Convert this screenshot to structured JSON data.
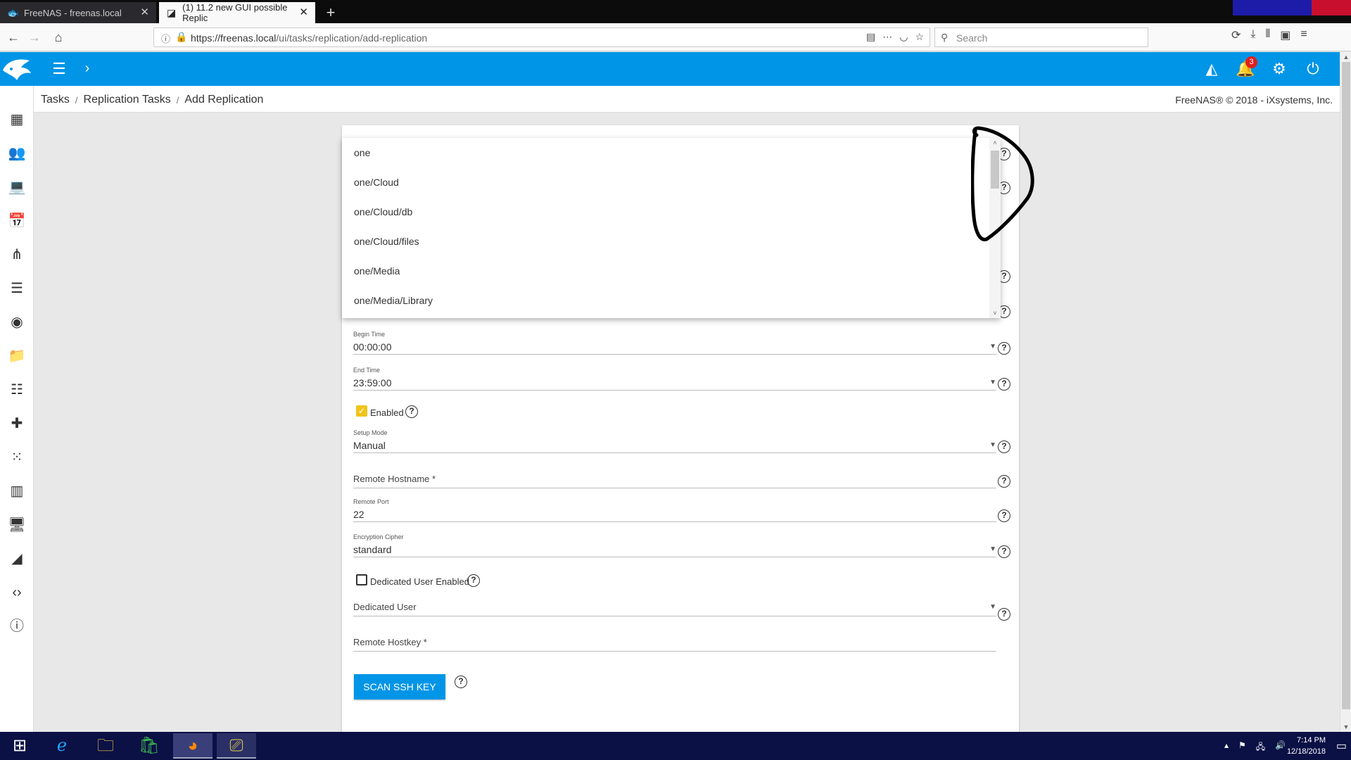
{
  "browser": {
    "tabs": [
      {
        "title": "FreeNAS - freenas.local",
        "active": false
      },
      {
        "title": "(1) 11.2 new GUI possible Replic",
        "active": true
      }
    ],
    "url_prefix": "https://freenas.local",
    "url_path": "/ui/tasks/replication/add-replication",
    "search_placeholder": "Search",
    "tab_close_glyph": "✕",
    "new_tab_glyph": "+"
  },
  "header": {
    "notification_count": "3"
  },
  "breadcrumb": {
    "items": [
      "Tasks",
      "Replication Tasks",
      "Add Replication"
    ],
    "separator": "/"
  },
  "copyright": "FreeNAS® © 2018 - iXsystems, Inc.",
  "dropdown": {
    "options": [
      "one",
      "one/Cloud",
      "one/Cloud/db",
      "one/Cloud/files",
      "one/Media",
      "one/Media/Library"
    ]
  },
  "form": {
    "begin_time": {
      "label": "Begin Time",
      "value": "00:00:00"
    },
    "end_time": {
      "label": "End Time",
      "value": "23:59:00"
    },
    "enabled": {
      "label": "Enabled",
      "checked": true
    },
    "setup_mode": {
      "label": "Setup Mode",
      "value": "Manual"
    },
    "remote_hostname": {
      "placeholder": "Remote Hostname *"
    },
    "remote_port": {
      "label": "Remote Port",
      "value": "22"
    },
    "encryption_cipher": {
      "label": "Encryption Cipher",
      "value": "standard"
    },
    "dedicated_user_enabled": {
      "label": "Dedicated User Enabled",
      "checked": false
    },
    "dedicated_user": {
      "placeholder": "Dedicated User"
    },
    "remote_hostkey": {
      "placeholder": "Remote Hostkey *"
    },
    "scan_button": "SCAN SSH KEY"
  },
  "taskbar": {
    "time": "7:14 PM",
    "date": "12/18/2018"
  },
  "colors": {
    "brand_blue": "#0095e7",
    "checkbox_yellow": "#f0c419",
    "badge_red": "#e02020"
  },
  "icons": {
    "sidebar": [
      "dashboard-icon",
      "accounts-icon",
      "system-icon",
      "tasks-icon",
      "network-icon",
      "storage-icon",
      "directory-services-icon",
      "sharing-icon",
      "services-icon",
      "plugins-icon",
      "jails-icon",
      "reporting-icon",
      "virtual-machines-icon",
      "display-system-processes-icon",
      "shell-icon",
      "guide-icon"
    ]
  }
}
